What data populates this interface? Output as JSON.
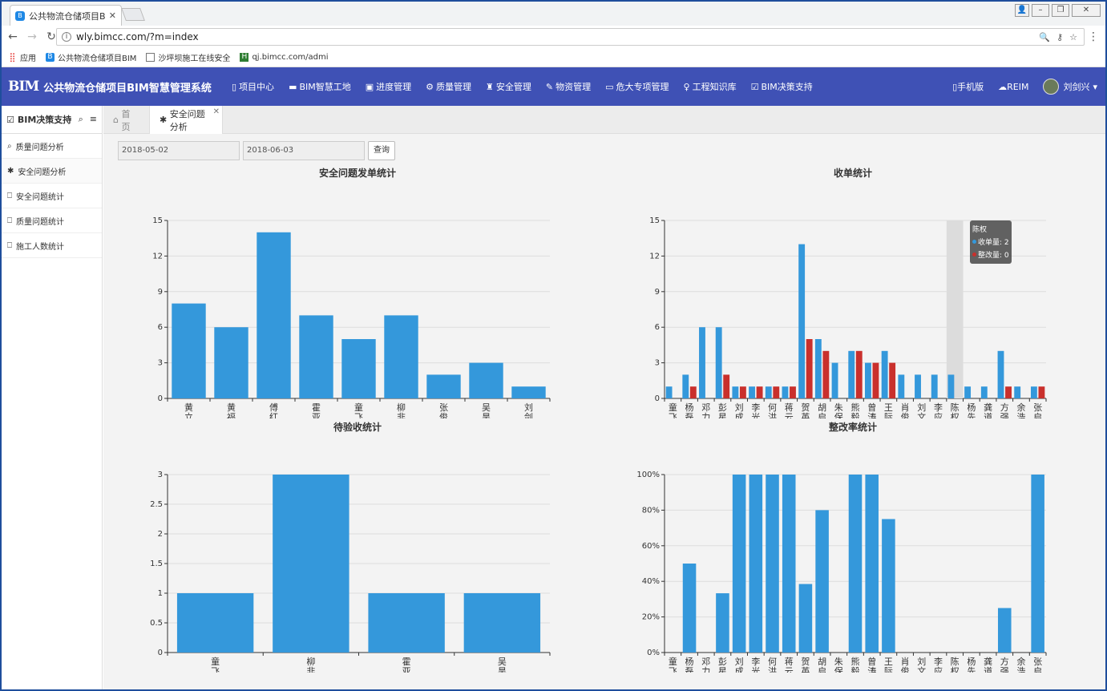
{
  "browser": {
    "tab_title": "公共物流仓储项目BIM智",
    "url": "wly.bimcc.com/?m=index",
    "bookmarks": [
      "应用",
      "公共物流仓储项目BIM",
      "沙坪坝施工在线安全",
      "qj.bimcc.com/admi"
    ]
  },
  "app": {
    "logo_mark": "BIM",
    "title": "公共物流仓储项目BIM智慧管理系统",
    "nav": [
      "项目中心",
      "BIM智慧工地",
      "进度管理",
      "质量管理",
      "安全管理",
      "物资管理",
      "危大专项管理",
      "工程知识库",
      "BIM决策支持"
    ],
    "right_nav": [
      "手机版",
      "REIM"
    ],
    "user": "刘剑兴"
  },
  "sidebar": {
    "title": "BIM决策支持",
    "items": [
      "质量问题分析",
      "安全问题分析",
      "安全问题统计",
      "质量问题统计",
      "施工人数统计"
    ]
  },
  "content": {
    "tabs": [
      "首页",
      "安全问题分析"
    ],
    "start_date": "2018-05-02",
    "end_date": "2018-06-03",
    "query_label": "查询"
  },
  "colors": {
    "blue": "#3498db",
    "red": "#c9302c",
    "header": "#3f51b5"
  },
  "tooltip": {
    "name": "陈权",
    "line1": "收单量: 2",
    "line2": "整改量: 0"
  },
  "chart_data": [
    {
      "type": "bar",
      "title": "安全问题发单统计",
      "categories": [
        "黄立业",
        "黄福益",
        "傅红兵",
        "霍亚中",
        "童飞1",
        "柳非凡",
        "张俊杰",
        "吴昊",
        "刘剑兴"
      ],
      "values": [
        8,
        6,
        14,
        7,
        5,
        7,
        2,
        3,
        1
      ],
      "ylim": [
        0,
        15
      ],
      "yticks": [
        "0",
        "3",
        "6",
        "9",
        "12",
        "15"
      ]
    },
    {
      "type": "bar",
      "title": "收单统计",
      "categories": [
        "童飞1",
        "杨磊",
        "邓力",
        "彭星霞",
        "刘成洪",
        "李光权",
        "何洪",
        "蒋云",
        "贺英杰",
        "胡启明",
        "朱保全",
        "熊毅",
        "曾涛",
        "王际雄",
        "肖俊",
        "刘文涵",
        "李应平",
        "陈权",
        "杨先均",
        "龚道荣",
        "方强",
        "余浩",
        "张启东"
      ],
      "series": [
        {
          "name": "收单量",
          "values": [
            1,
            2,
            6,
            6,
            1,
            1,
            1,
            1,
            13,
            5,
            3,
            4,
            3,
            4,
            2,
            2,
            2,
            2,
            1,
            1,
            4,
            1,
            1
          ]
        },
        {
          "name": "整改量",
          "values": [
            0,
            1,
            0,
            2,
            1,
            1,
            1,
            1,
            5,
            4,
            0,
            4,
            3,
            3,
            0,
            0,
            0,
            0,
            0,
            0,
            1,
            0,
            1
          ]
        }
      ],
      "ylim": [
        0,
        15
      ],
      "yticks": [
        "0",
        "3",
        "6",
        "9",
        "12",
        "15"
      ],
      "highlight_index": 17
    },
    {
      "type": "bar",
      "title": "待验收统计",
      "categories": [
        "童飞1",
        "柳非凡",
        "霍亚中",
        "吴昊"
      ],
      "values": [
        1,
        3,
        1,
        1
      ],
      "ylim": [
        0,
        3
      ],
      "yticks": [
        "0",
        "0.5",
        "1",
        "1.5",
        "2",
        "2.5",
        "3"
      ]
    },
    {
      "type": "bar",
      "title": "整改率统计",
      "categories": [
        "童飞1",
        "杨磊",
        "邓力",
        "彭星霞",
        "刘成洪",
        "李光权",
        "何洪",
        "蒋云",
        "贺英杰",
        "胡启明",
        "朱保全",
        "熊毅",
        "曾涛",
        "王际雄",
        "肖俊",
        "刘文涵",
        "李应平",
        "陈权",
        "杨先均",
        "龚道荣",
        "方强",
        "余浩",
        "张启东"
      ],
      "values": [
        0,
        50,
        0,
        33.3,
        100,
        100,
        100,
        100,
        38.5,
        80,
        0,
        100,
        100,
        75,
        0,
        0,
        0,
        0,
        0,
        0,
        25,
        0,
        100
      ],
      "ylim": [
        0,
        100
      ],
      "yticks": [
        "0%",
        "20%",
        "40%",
        "60%",
        "80%",
        "100%"
      ]
    }
  ]
}
